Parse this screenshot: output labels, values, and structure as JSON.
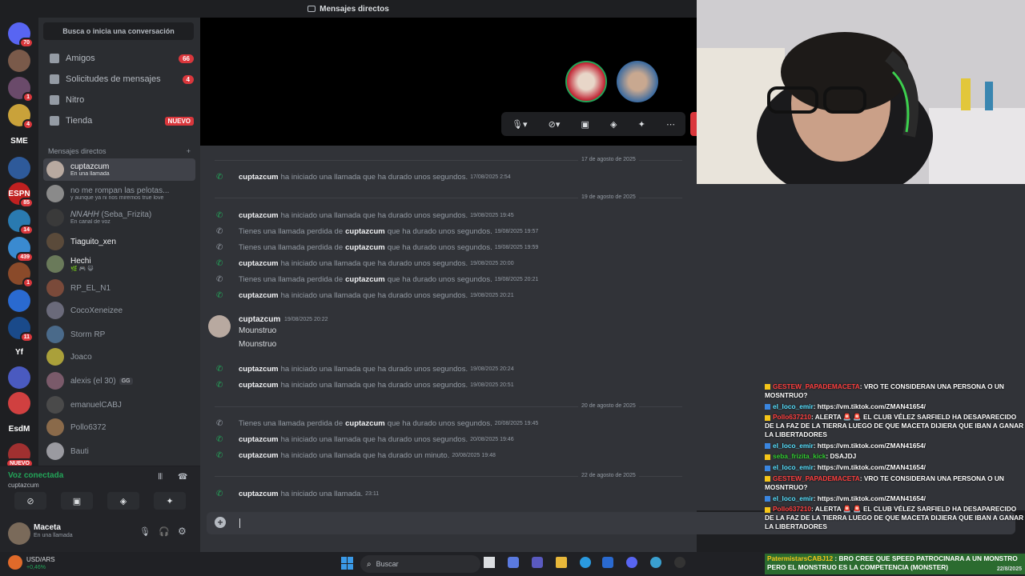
{
  "topbar": {
    "title": "Mensajes directos"
  },
  "rail": {
    "servers": [
      {
        "label": "",
        "badge": "70",
        "color": "#5865f2"
      },
      {
        "label": "",
        "badge": "",
        "color": "#7a5a4a"
      },
      {
        "label": "",
        "badge": "1",
        "color": "#6a4a6a"
      },
      {
        "label": "",
        "badge": "4",
        "color": "#c9a23a"
      },
      {
        "label": "SME",
        "badge": "",
        "color": "#1e1f22"
      },
      {
        "label": "",
        "badge": "",
        "color": "#2e5a9a"
      },
      {
        "label": "ESPN",
        "badge": "85",
        "color": "#c02020"
      },
      {
        "label": "",
        "badge": "14",
        "color": "#2a7ab0"
      },
      {
        "label": "",
        "badge": "439",
        "color": "#3a8ad0"
      },
      {
        "label": "",
        "badge": "1",
        "color": "#8a4a2a"
      },
      {
        "label": "",
        "badge": "",
        "color": "#2a6ad0"
      },
      {
        "label": "",
        "badge": "11",
        "color": "#1a4a8a"
      },
      {
        "label": "Yf",
        "badge": "",
        "color": "#1e1f22"
      },
      {
        "label": "",
        "badge": "",
        "color": "#4a5ac0"
      },
      {
        "label": "",
        "badge": "",
        "color": "#d04040"
      },
      {
        "label": "EsdM",
        "badge": "",
        "color": "#1e1f22"
      },
      {
        "label": "",
        "badge": "NUEVO",
        "color": "#a03030"
      }
    ]
  },
  "sidebar": {
    "search_placeholder": "Busca o inicia una conversación",
    "nav": [
      {
        "label": "Amigos",
        "count": "66"
      },
      {
        "label": "Solicitudes de mensajes",
        "count": "4"
      },
      {
        "label": "Nitro",
        "count": ""
      },
      {
        "label": "Tienda",
        "tag": "NUEVO"
      }
    ],
    "dm_header": "Mensajes directos",
    "dm_add": "+",
    "dms": [
      {
        "name": "cuptazcum",
        "sub": "En una llamada",
        "color": "#b8a9a0"
      },
      {
        "name": "no me rompan las pelotas...",
        "sub": "y aunque ya ni nos miremos true love",
        "color": "#8a8a8a"
      },
      {
        "name": "𝑁𝑁𝐴𝐻𝐻 (Seba_Frizita)",
        "sub": "En canal de voz",
        "color": "#3a3a3a"
      },
      {
        "name": "Tiaguito_xen",
        "sub": "",
        "color": "#5a4a3a"
      },
      {
        "name": "Hechi",
        "sub": "🌿 🎮 😺",
        "color": "#6a7a5a"
      },
      {
        "name": "RP_EL_N1",
        "sub": "",
        "color": "#7a4a3a"
      },
      {
        "name": "CocoXeneizee",
        "sub": "",
        "color": "#6a6a7a"
      },
      {
        "name": "Storm RP",
        "sub": "",
        "color": "#4a6a8a"
      },
      {
        "name": "Joaco",
        "sub": "",
        "color": "#aaa03a"
      },
      {
        "name": "alexis (el 30)",
        "sub": "",
        "tag": "GG",
        "color": "#7a5a6a"
      },
      {
        "name": "emanuelCABJ",
        "sub": "",
        "color": "#4a4a4a"
      },
      {
        "name": "Pollo6372",
        "sub": "",
        "color": "#8a6a4a"
      },
      {
        "name": "Bauti",
        "sub": "",
        "color": "#9a9aa0"
      }
    ]
  },
  "voice_panel": {
    "status": "Voz conectada",
    "channel": "cuptazcum"
  },
  "user_panel": {
    "name": "Maceta",
    "status": "En una llamada"
  },
  "chat": {
    "dividers": [
      "17 de agosto de 2025",
      "19 de agosto de 2025",
      "20 de agosto de 2025",
      "22 de agosto de 2025"
    ],
    "messages": [
      {
        "type": "call",
        "user": "cuptazcum",
        "text": "ha iniciado una llamada que ha durado unos segundos.",
        "ts": "17/08/2025 2:54"
      },
      {
        "type": "call",
        "user": "cuptazcum",
        "text": "ha iniciado una llamada que ha durado unos segundos.",
        "ts": "19/08/2025 19:45"
      },
      {
        "type": "missed",
        "pre": "Tienes una llamada perdida de",
        "user": "cuptazcum",
        "text": "que ha durado unos segundos.",
        "ts": "19/08/2025 19:57"
      },
      {
        "type": "missed",
        "pre": "Tienes una llamada perdida de",
        "user": "cuptazcum",
        "text": "que ha durado unos segundos.",
        "ts": "19/08/2025 19:59"
      },
      {
        "type": "call",
        "user": "cuptazcum",
        "text": "ha iniciado una llamada que ha durado unos segundos.",
        "ts": "19/08/2025 20:00"
      },
      {
        "type": "missed",
        "pre": "Tienes una llamada perdida de",
        "user": "cuptazcum",
        "text": "que ha durado unos segundos.",
        "ts": "19/08/2025 20:21"
      },
      {
        "type": "call",
        "user": "cuptazcum",
        "text": "ha iniciado una llamada que ha durado unos segundos.",
        "ts": "19/08/2025 20:21"
      },
      {
        "type": "call",
        "user": "cuptazcum",
        "text": "ha iniciado una llamada que ha durado unos segundos.",
        "ts": "19/08/2025 20:24"
      },
      {
        "type": "call",
        "user": "cuptazcum",
        "text": "ha iniciado una llamada que ha durado unos segundos.",
        "ts": "19/08/2025 20:51"
      },
      {
        "type": "missed",
        "pre": "Tienes una llamada perdida de",
        "user": "cuptazcum",
        "text": "que ha durado unos segundos.",
        "ts": "20/08/2025 19:45"
      },
      {
        "type": "call",
        "user": "cuptazcum",
        "text": "ha iniciado una llamada que ha durado unos segundos.",
        "ts": "20/08/2025 19:46"
      },
      {
        "type": "call",
        "user": "cuptazcum",
        "text": "ha iniciado una llamada que ha durado un minuto.",
        "ts": "20/08/2025 19:48"
      },
      {
        "type": "call",
        "user": "cuptazcum",
        "text": "ha iniciado una llamada.",
        "ts": "23:11"
      }
    ],
    "user_message": {
      "user": "cuptazcum",
      "ts": "19/08/2025 20:22",
      "lines": [
        "Mounstruo",
        "Mounstruo"
      ]
    }
  },
  "twitch_chat": [
    {
      "user": "GESTEW_PAPADEMACETA",
      "ucls": "u1",
      "text": ": VRO TE CONSIDERAN UNA PERSONA O UN MOSNTRUO?"
    },
    {
      "user": "el_loco_emir",
      "ucls": "u2",
      "text": ": https://vm.tiktok.com/ZMAN41654/"
    },
    {
      "user": "Pollo637210",
      "ucls": "u1",
      "text": ": ALERTA 🚨 🚨 EL CLUB VÉLEZ SARFIELD HA DESAPARECIDO DE LA FAZ DE LA TIERRA LUEGO DE QUE MACETA DIJIERA QUE IBAN A GANAR LA LIBERTADORES"
    },
    {
      "user": "el_loco_emir",
      "ucls": "u2",
      "text": ": https://vm.tiktok.com/ZMAN41654/"
    },
    {
      "user": "seba_frizita_kick",
      "ucls": "u3",
      "text": ": DSAJDJ"
    },
    {
      "user": "el_loco_emir",
      "ucls": "u2",
      "text": ": https://vm.tiktok.com/ZMAN41654/"
    },
    {
      "user": "GESTEW_PAPADEMACETA",
      "ucls": "u1",
      "text": ": VRO TE CONSIDERAN UNA PERSONA O UN MOSNTRUO?"
    },
    {
      "user": "el_loco_emir",
      "ucls": "u2",
      "text": ": https://vm.tiktok.com/ZMAN41654/"
    },
    {
      "user": "Pollo637210",
      "ucls": "u1",
      "text": ": ALERTA 🚨 🚨 EL CLUB VÉLEZ SARFIELD HA DESAPARECIDO DE LA FAZ DE LA TIERRA LUEGO DE QUE MACETA DIJIERA QUE IBAN A GANAR LA LIBERTADORES"
    }
  ],
  "twitch_last": {
    "user": "PatermistarsCABJ12",
    "text": ": BRO CREE QUE SPEED PATROCINARA A UN MONSTRO PERO EL MONSTRUO ES LA COMPETENCIA (MONSTER)"
  },
  "taskbar": {
    "ticker": "USD/ARS",
    "change": "+0,46%",
    "search": "Buscar",
    "date": "22/8/2025"
  },
  "colors": {
    "accent": "#5865f2",
    "green": "#23a559",
    "red": "#da373c"
  }
}
